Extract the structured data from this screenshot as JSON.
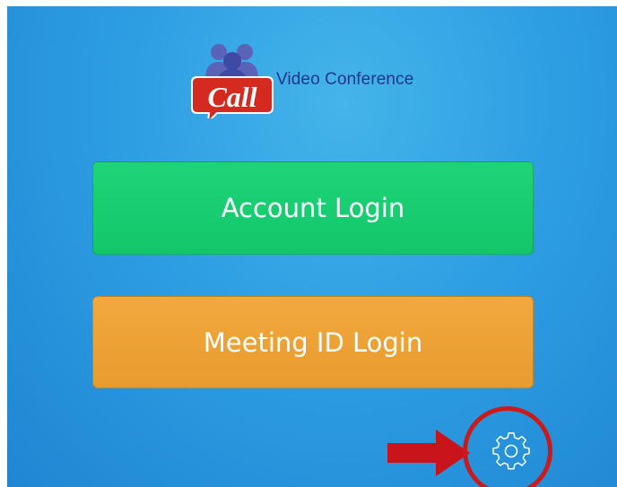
{
  "app": {
    "logo_text": "Call",
    "brand_name": "Video Conference"
  },
  "buttons": {
    "account_login": "Account Login",
    "meeting_id_login": "Meeting ID Login"
  },
  "icons": {
    "settings": "gear-icon",
    "annotation_arrow": "arrow-right-icon"
  },
  "colors": {
    "background": "#2e9ee3",
    "account_button": "#16cb6f",
    "meeting_button": "#eea134",
    "annotation": "#cc1a1a",
    "brand_text": "#22378c"
  }
}
